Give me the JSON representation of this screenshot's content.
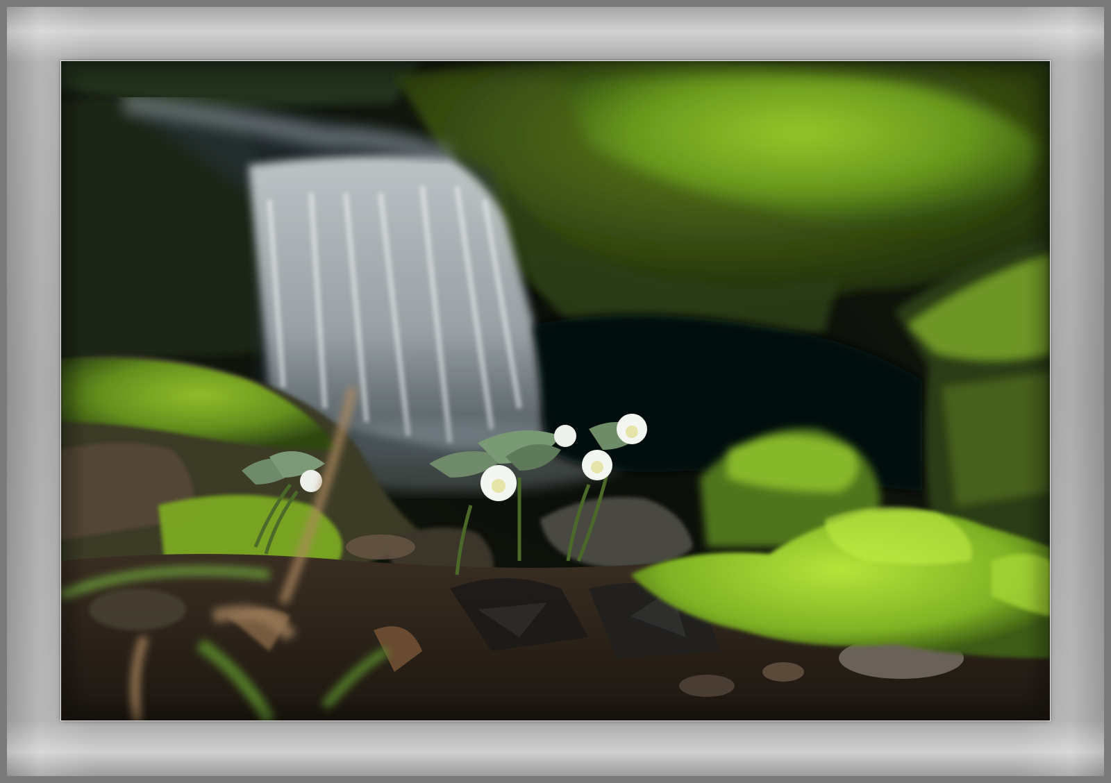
{
  "frame": {
    "color": "#a0a0a0"
  },
  "photo": {
    "subject": [
      "waterfall-icon",
      "moss-rock-icon",
      "white-flower-icon"
    ]
  }
}
